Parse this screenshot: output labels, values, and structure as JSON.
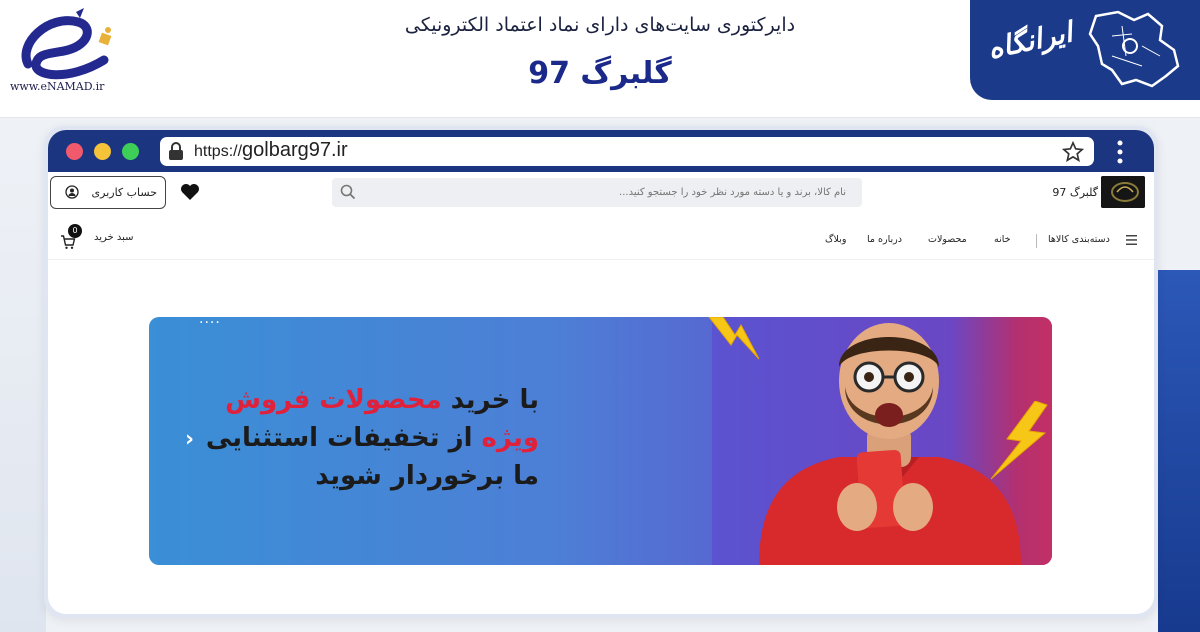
{
  "enamad": {
    "url": "www.eNAMAD.ir"
  },
  "header": {
    "directory_title": "دایرکتوری سایت‌های دارای نماد اعتماد الکترونیکی",
    "site_title": "گلبرگ 97"
  },
  "irangah": {
    "logo_text": "ایرانگاه"
  },
  "browser": {
    "url_protocol": "https://",
    "url_domain": "golbarg97.ir"
  },
  "site": {
    "brand_name": "گلبرگ 97",
    "account_label": "حساب کاربری",
    "search_placeholder": "نام کالا، برند و یا دسته مورد نظر خود را جستجو کنید...",
    "cart_label": "سبد خرید",
    "cart_count": "0",
    "nav": {
      "categories": "دسته‌بندی کالاها",
      "home": "خانه",
      "products": "محصولات",
      "about": "درباره ما",
      "blog": "وبلاگ"
    }
  },
  "banner": {
    "line1_start": "با خرید ",
    "line1_highlight": "محصولات فروش",
    "line2_highlight": "ویژه",
    "line2_end": " از تخفیفات استثنایی",
    "line3": "ما برخوردار شوید",
    "dots": "....",
    "accent_color": "#e0213b"
  },
  "colors": {
    "chrome_bar": "#1c3580",
    "irangah_bg": "#1b3a8a"
  }
}
